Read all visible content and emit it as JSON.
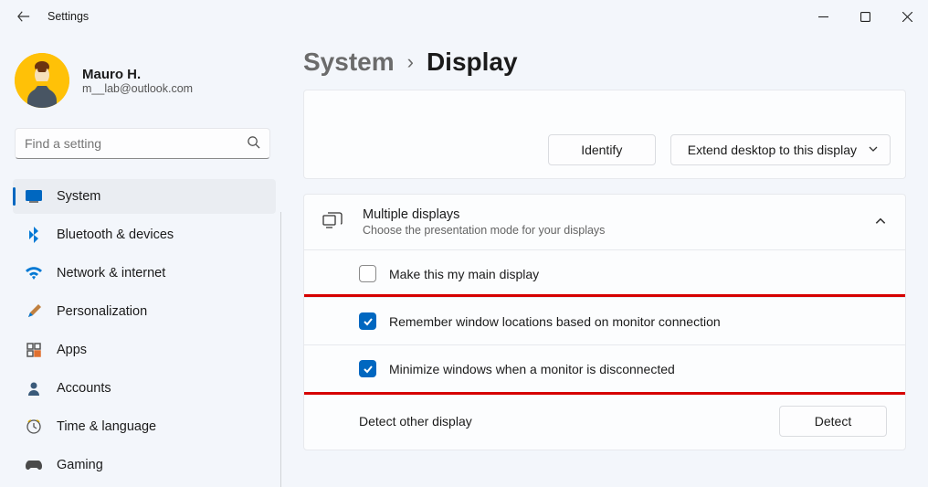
{
  "window": {
    "title": "Settings"
  },
  "profile": {
    "name": "Mauro H.",
    "email": "m__lab@outlook.com"
  },
  "search": {
    "placeholder": "Find a setting"
  },
  "sidebar": {
    "items": [
      {
        "label": "System",
        "icon": "system"
      },
      {
        "label": "Bluetooth & devices",
        "icon": "bluetooth"
      },
      {
        "label": "Network & internet",
        "icon": "wifi"
      },
      {
        "label": "Personalization",
        "icon": "brush"
      },
      {
        "label": "Apps",
        "icon": "apps"
      },
      {
        "label": "Accounts",
        "icon": "person"
      },
      {
        "label": "Time & language",
        "icon": "clock"
      },
      {
        "label": "Gaming",
        "icon": "game"
      }
    ],
    "selected_index": 0
  },
  "breadcrumb": {
    "parent": "System",
    "leaf": "Display"
  },
  "buttons": {
    "identify": "Identify",
    "extend_dropdown": "Extend desktop to this display",
    "detect": "Detect"
  },
  "multiple_displays": {
    "title": "Multiple displays",
    "subtitle": "Choose the presentation mode for your displays",
    "main_display": {
      "label": "Make this my main display",
      "checked": false
    },
    "remember_locations": {
      "label": "Remember window locations based on monitor connection",
      "checked": true
    },
    "minimize_disconnect": {
      "label": "Minimize windows when a monitor is disconnected",
      "checked": true
    },
    "detect_label": "Detect other display"
  }
}
